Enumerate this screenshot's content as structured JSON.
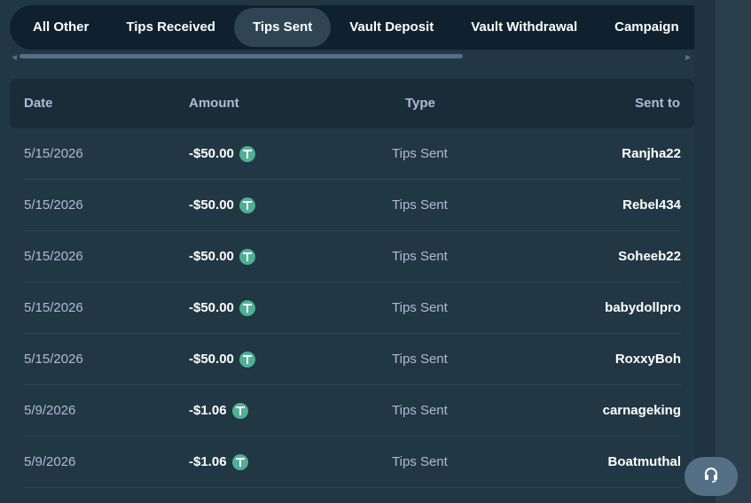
{
  "tabs": [
    {
      "label": "All Other",
      "active": false
    },
    {
      "label": "Tips Received",
      "active": false
    },
    {
      "label": "Tips Sent",
      "active": true
    },
    {
      "label": "Vault Deposit",
      "active": false
    },
    {
      "label": "Vault Withdrawal",
      "active": false
    },
    {
      "label": "Campaign",
      "active": false
    }
  ],
  "table": {
    "headers": {
      "date": "Date",
      "amount": "Amount",
      "type": "Type",
      "sent_to": "Sent to"
    },
    "rows": [
      {
        "date": "5/15/2026",
        "amount": "-$50.00",
        "type": "Tips Sent",
        "sent_to": "Ranjha22"
      },
      {
        "date": "5/15/2026",
        "amount": "-$50.00",
        "type": "Tips Sent",
        "sent_to": "Rebel434"
      },
      {
        "date": "5/15/2026",
        "amount": "-$50.00",
        "type": "Tips Sent",
        "sent_to": "Soheeb22"
      },
      {
        "date": "5/15/2026",
        "amount": "-$50.00",
        "type": "Tips Sent",
        "sent_to": "babydollpro"
      },
      {
        "date": "5/15/2026",
        "amount": "-$50.00",
        "type": "Tips Sent",
        "sent_to": "RoxxyBoh"
      },
      {
        "date": "5/9/2026",
        "amount": "-$1.06",
        "type": "Tips Sent",
        "sent_to": "carnageking"
      },
      {
        "date": "5/9/2026",
        "amount": "-$1.06",
        "type": "Tips Sent",
        "sent_to": "Boatmuthal"
      }
    ]
  },
  "icons": {
    "currency": "tether-coin-icon",
    "support": "headset-icon",
    "scroll_left": "scroll-left-icon",
    "scroll_right": "scroll-right-icon"
  },
  "colors": {
    "background": "#213743",
    "tab_bar": "#0f212e",
    "tab_active": "#2f4553",
    "coin": "#50af95",
    "support_button": "#557086"
  }
}
